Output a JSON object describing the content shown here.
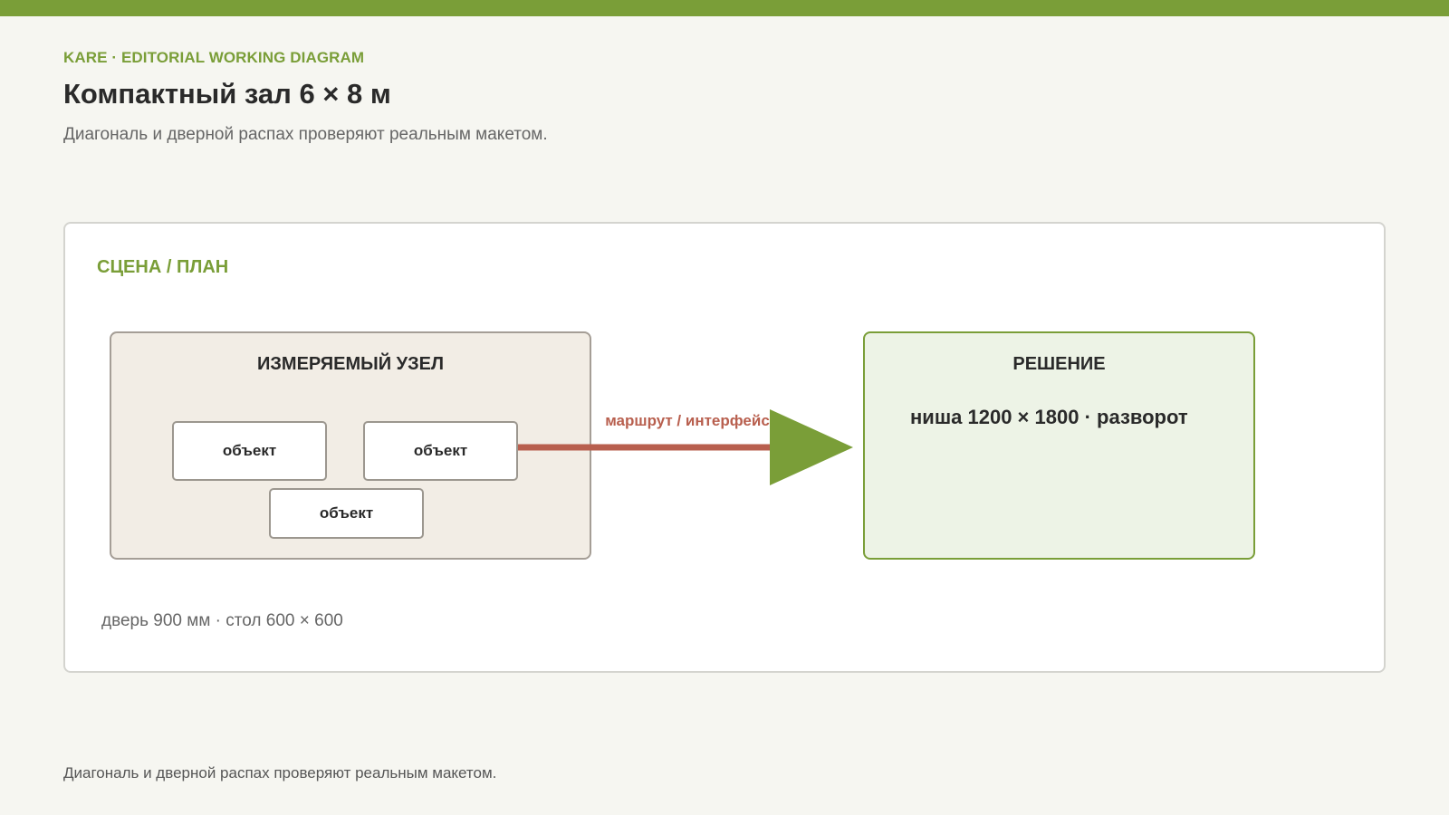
{
  "colors": {
    "accent": "#7a9e38",
    "link": "#b85f4e",
    "node_fill": "#f2ede5",
    "solution_fill": "#edf3e6"
  },
  "header": {
    "eyebrow": "KARE · EDITORIAL WORKING DIAGRAM",
    "title": "Компактный зал 6 × 8 м",
    "subtitle": "Диагональ и дверной распах проверяют реальным макетом."
  },
  "panel": {
    "label": "СЦЕНА / ПЛАН",
    "node": {
      "title": "ИЗМЕРЯЕМЫЙ УЗЕЛ",
      "objects": [
        "объект",
        "объект",
        "объект"
      ]
    },
    "link_label": "маршрут / интерфейс",
    "solution": {
      "title": "РЕШЕНИЕ",
      "text": "ниша 1200 × 1800 · разворот"
    },
    "note": "дверь 900 мм · стол 600 × 600"
  },
  "footer": {
    "text": "Диагональ и дверной распах проверяют реальным макетом."
  }
}
